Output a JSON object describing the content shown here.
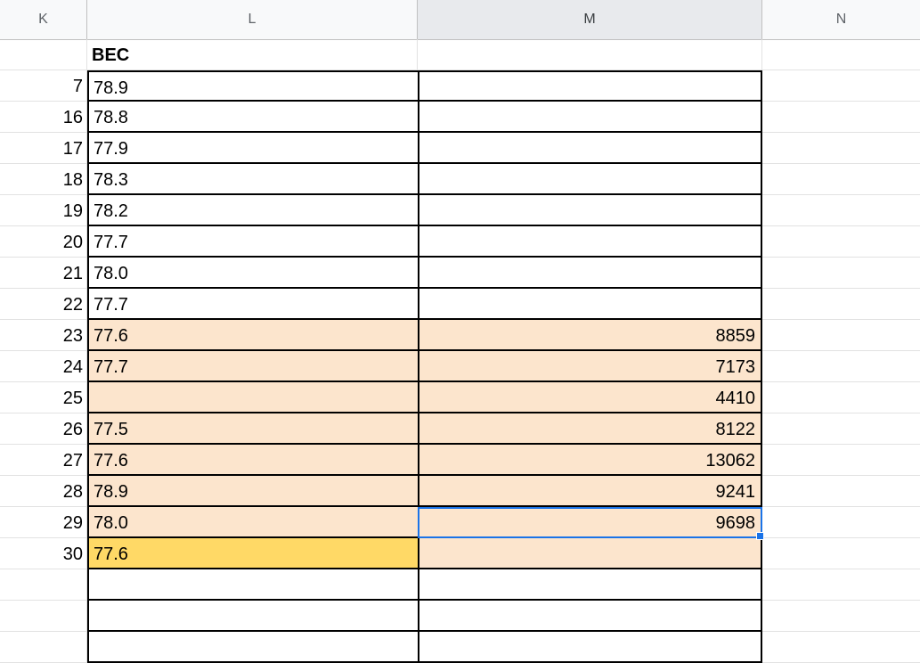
{
  "columns": [
    "K",
    "L",
    "M",
    "N"
  ],
  "header_row": {
    "k": "",
    "l": "BEC",
    "m": "",
    "n": ""
  },
  "rows": [
    {
      "k": "7",
      "l": "78.9",
      "m": ""
    },
    {
      "k": "16",
      "l": "78.8",
      "m": ""
    },
    {
      "k": "17",
      "l": "77.9",
      "m": ""
    },
    {
      "k": "18",
      "l": "78.3",
      "m": ""
    },
    {
      "k": "19",
      "l": "78.2",
      "m": ""
    },
    {
      "k": "20",
      "l": "77.7",
      "m": ""
    },
    {
      "k": "21",
      "l": "78.0",
      "m": ""
    },
    {
      "k": "22",
      "l": "77.7",
      "m": ""
    },
    {
      "k": "23",
      "l": "77.6",
      "m": "8859"
    },
    {
      "k": "24",
      "l": "77.7",
      "m": "7173"
    },
    {
      "k": "25",
      "l": "",
      "m": "4410"
    },
    {
      "k": "26",
      "l": "77.5",
      "m": "8122"
    },
    {
      "k": "27",
      "l": "77.6",
      "m": "13062"
    },
    {
      "k": "28",
      "l": "78.9",
      "m": "9241"
    },
    {
      "k": "29",
      "l": "78.0",
      "m": "9698"
    },
    {
      "k": "30",
      "l": "77.6",
      "m": ""
    },
    {
      "k": "",
      "l": "",
      "m": ""
    },
    {
      "k": "",
      "l": "",
      "m": ""
    },
    {
      "k": "",
      "l": "",
      "m": ""
    }
  ],
  "colors": {
    "peach_fill": "#fce5cd",
    "yellow_fill": "#ffd966",
    "selection": "#1a73e8"
  },
  "selected_cell": "M29"
}
